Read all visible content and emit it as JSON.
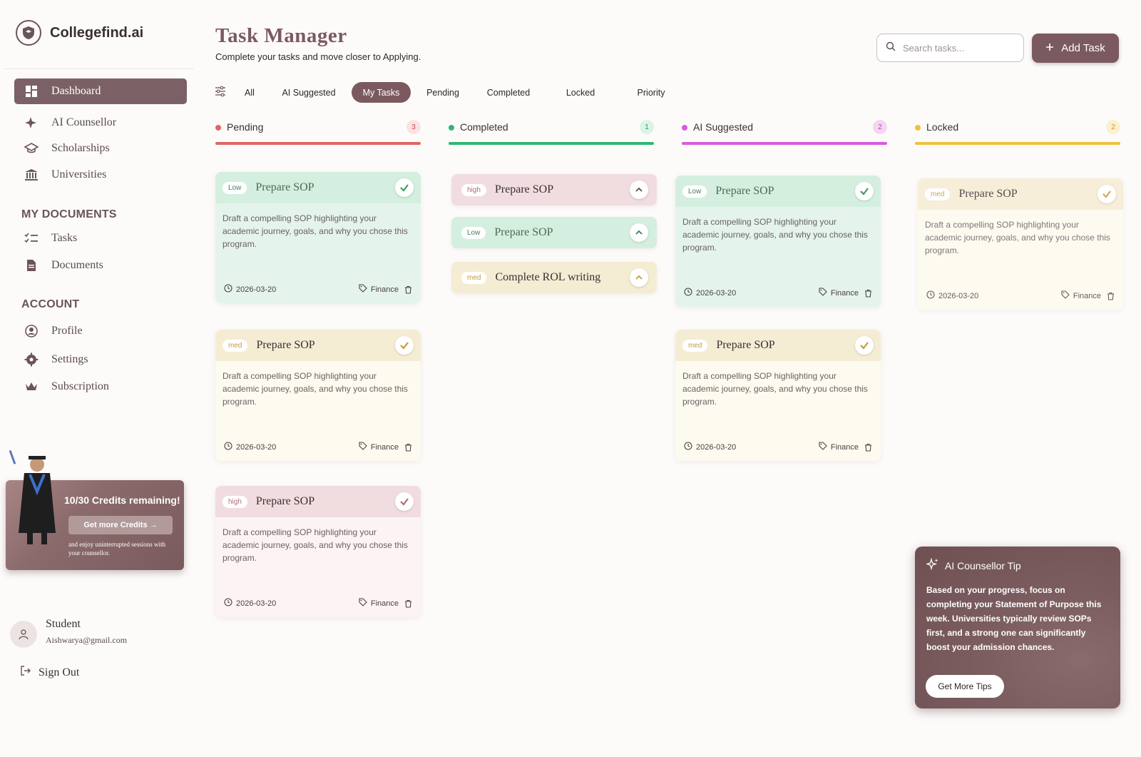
{
  "brand": {
    "name": "Collegefind.ai"
  },
  "nav": {
    "dashboard": "Dashboard",
    "ai_counsellor": "AI Counsellor",
    "scholarships": "Scholarships",
    "universities": "Universities",
    "section_documents": "MY DOCUMENTS",
    "tasks": "Tasks",
    "documents": "Documents",
    "section_account": "ACCOUNT",
    "profile": "Profile",
    "settings": "Settings",
    "subscription": "Subscription"
  },
  "promo": {
    "title": "10/30 Credits remaining!",
    "button": "Get more Credits →",
    "subtitle": "and enjoy uninterrupted sessions with your counsellor."
  },
  "user": {
    "name": "Student",
    "email": "Aishwarya@gmail.com",
    "sign_out": "Sign Out"
  },
  "header": {
    "title": "Task Manager",
    "subtitle": "Complete your tasks and move closer to Applying.",
    "search_placeholder": "Search tasks...",
    "add_task": "Add Task"
  },
  "filters": [
    "All",
    "AI Suggested",
    "My Tasks",
    "Pending",
    "Completed",
    "Locked",
    "Priority"
  ],
  "active_filter": "My Tasks",
  "columns": [
    {
      "label": "Pending",
      "count": "3",
      "color": "#e06666"
    },
    {
      "label": "Completed",
      "count": "1",
      "color": "#2eb872"
    },
    {
      "label": "AI Suggested",
      "count": "2",
      "color": "#d65ddb"
    },
    {
      "label": "Locked",
      "count": "2",
      "color": "#efc23a"
    }
  ],
  "task": {
    "title": "Prepare SOP",
    "description": "Draft a compelling SOP highlighting your academic journey, goals, and why you chose this program.",
    "date": "2026-03-20",
    "tag": "Finance"
  },
  "priorities": {
    "low": "Low",
    "med": "med",
    "high": "high"
  },
  "completed_tasks": [
    {
      "priority": "high",
      "title": "Prepare SOP"
    },
    {
      "priority": "Low",
      "title": "Prepare SOP"
    },
    {
      "priority": "med",
      "title": "Complete ROL writing"
    }
  ],
  "tip": {
    "title": "AI Counsellor Tip",
    "text": "Based on your progress, focus on completing your Statement of Purpose this week. Universities typically review SOPs first, and a strong one can significantly boost your admission chances.",
    "button": "Get More Tips"
  },
  "colors": {
    "accent": "#7b5a5f",
    "sidebar_active": "#7b6165"
  }
}
